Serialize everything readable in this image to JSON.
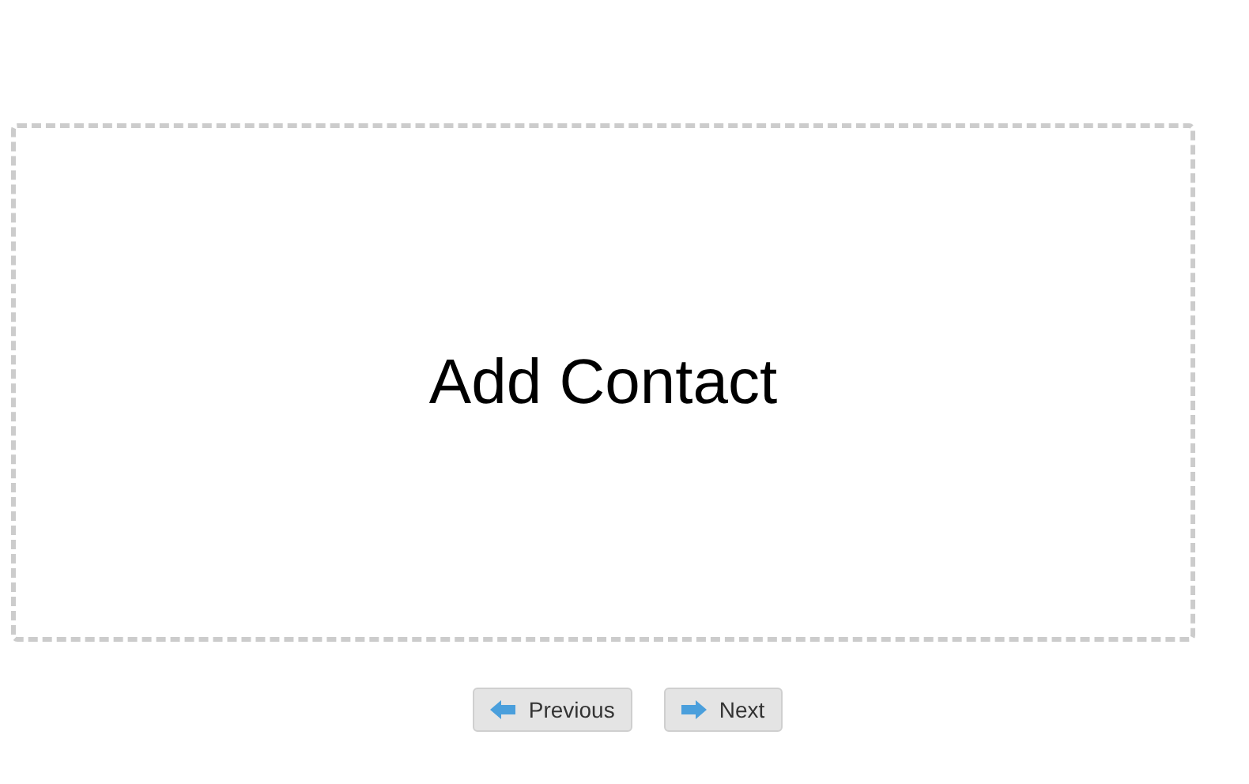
{
  "slide": {
    "title": "Add Contact"
  },
  "buttons": [
    {
      "label": "Previous",
      "kind": "previous"
    },
    {
      "label": "Next",
      "kind": "next"
    }
  ]
}
